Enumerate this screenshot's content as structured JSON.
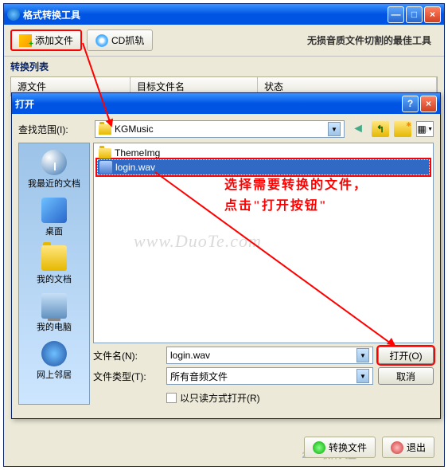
{
  "main": {
    "title": "格式转换工具",
    "toolbar": {
      "add_file": "添加文件",
      "cd_rip": "CD抓轨",
      "tagline": "无损音质文件切割的最佳工具"
    },
    "list_label": "转换列表",
    "headers": {
      "source": "源文件",
      "target": "目标文件名",
      "status": "状态"
    },
    "bottom": {
      "convert": "转换文件",
      "exit": "退出"
    }
  },
  "dialog": {
    "title": "打开",
    "lookin_label": "查找范围(I):",
    "lookin_value": "KGMusic",
    "places": {
      "recent": "我最近的文档",
      "desktop": "桌面",
      "mydocs": "我的文档",
      "computer": "我的电脑",
      "network": "网上邻居"
    },
    "files": {
      "folder": "ThemeImg",
      "selected": "login.wav"
    },
    "filename_label": "文件名(N):",
    "filename_value": "login.wav",
    "filetype_label": "文件类型(T):",
    "filetype_value": "所有音频文件",
    "open_btn": "打开(O)",
    "cancel_btn": "取消",
    "readonly": "以只读方式打开(R)"
  },
  "annotation": "选择需要转换的文件，点击\"打开按钮\"",
  "watermark": "www.DuoTe.com",
  "bottom_watermark": "2345软件大全"
}
